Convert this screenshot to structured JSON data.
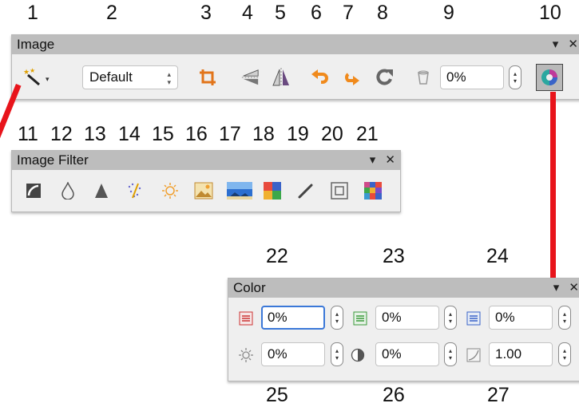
{
  "numbers": [
    "1",
    "2",
    "3",
    "4",
    "5",
    "6",
    "7",
    "8",
    "9",
    "10",
    "11",
    "12",
    "13",
    "14",
    "15",
    "16",
    "17",
    "18",
    "19",
    "20",
    "21",
    "22",
    "23",
    "24",
    "25",
    "26",
    "27"
  ],
  "image_toolbar": {
    "title": "Image",
    "mode_value": "Default",
    "transparency_value": "0%"
  },
  "filter_toolbar": {
    "title": "Image Filter"
  },
  "color_toolbar": {
    "title": "Color",
    "red": "0%",
    "green": "0%",
    "blue": "0%",
    "brightness": "0%",
    "contrast": "0%",
    "gamma": "1.00"
  },
  "window_controls": {
    "menu": "▾",
    "close": "✕"
  },
  "colors": {
    "connector": "#e8141b",
    "titlebar": "#bdbdbd",
    "focus": "#3b78d8"
  }
}
